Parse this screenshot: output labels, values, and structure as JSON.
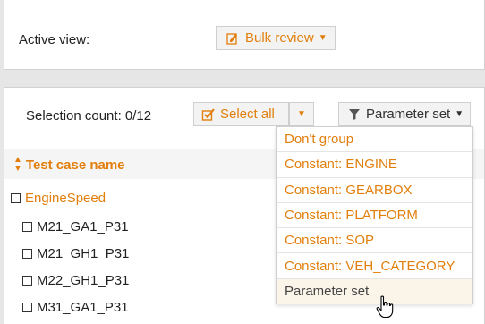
{
  "active_view": {
    "label": "Active view:",
    "button_label": "Bulk review",
    "button_icon": "edit-icon"
  },
  "toolbar": {
    "selection_count": "Selection count: 0/12",
    "select_all_label": "Select all",
    "select_all_icon": "checkbox-check-icon",
    "parameter_set_label": "Parameter set",
    "parameter_set_icon": "filter-icon"
  },
  "table": {
    "column_header": "Test case name",
    "group": "EngineSpeed",
    "rows": [
      "M21_GA1_P31",
      "M21_GH1_P31",
      "M22_GH1_P31",
      "M31_GA1_P31"
    ]
  },
  "dropdown": {
    "items": [
      "Don't group",
      "Constant: ENGINE",
      "Constant: GEARBOX",
      "Constant: PLATFORM",
      "Constant: SOP",
      "Constant: VEH_CATEGORY",
      "Parameter set"
    ],
    "selected": "Parameter set"
  },
  "colors": {
    "accent": "#e27f0c",
    "background": "#e6e6e6",
    "panel": "#ffffff",
    "selected_item": "#fbf5e9"
  }
}
